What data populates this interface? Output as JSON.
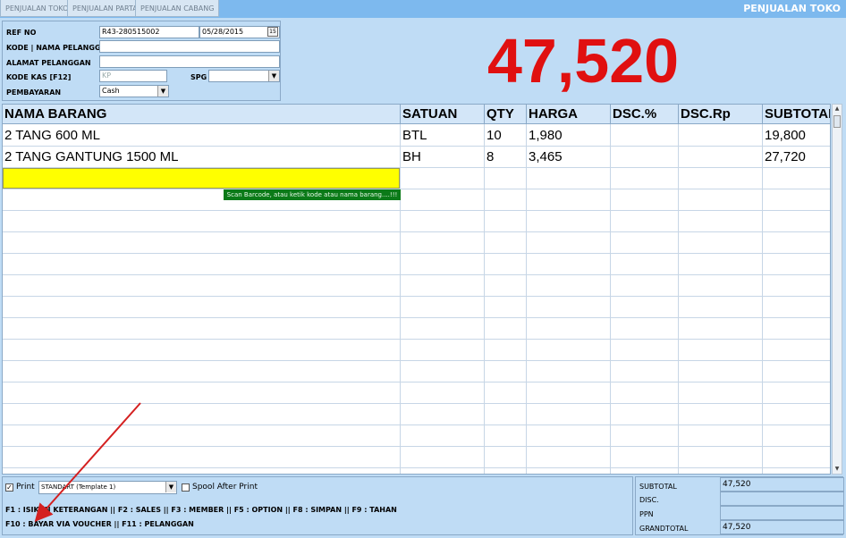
{
  "tabs": [
    {
      "label": "PENJUALAN TOKO"
    },
    {
      "label": "PENJUALAN PARTAI"
    },
    {
      "label": "PENJUALAN CABANG"
    }
  ],
  "app_title": "PENJUALAN TOKO",
  "form": {
    "ref_no_label": "REF NO",
    "ref_no_value": "R43-280515002",
    "date_value": "05/28/2015",
    "customer_label": "KODE | NAMA PELANGGAN",
    "address_label": "ALAMAT PELANGGAN",
    "kas_label": "KODE KAS [F12]",
    "kas_value": "KP",
    "spg_label": "SPG",
    "payment_label": "PEMBAYARAN",
    "payment_value": "Cash"
  },
  "grand_display": "47,520",
  "grid": {
    "columns": [
      "NAMA BARANG",
      "SATUAN",
      "QTY",
      "HARGA",
      "DSC.%",
      "DSC.Rp",
      "SUBTOTAL"
    ],
    "rows": [
      [
        "2 TANG 600 ML",
        "BTL",
        "10",
        "1,980",
        "",
        "",
        "19,800"
      ],
      [
        "2 TANG GANTUNG 1500 ML",
        "BH",
        "8",
        "3,465",
        "",
        "",
        "27,720"
      ]
    ],
    "hint": "Scan Barcode, atau ketik kode atau nama barang....!!!"
  },
  "print": {
    "print_label": "Print",
    "template_value": "STANDART (Template 1)",
    "spool_label": "Spool After Print"
  },
  "shortcuts": {
    "line1": "F1 : ISIKAN KETERANGAN || F2 : SALES || F3 : MEMBER || F5 : OPTION || F8 : SIMPAN || F9 : TAHAN",
    "line2": "F10 : BAYAR VIA VOUCHER  || F11 : PELANGGAN"
  },
  "totals": {
    "subtotal_label": "SUBTOTAL",
    "subtotal_value": "47,520",
    "disc_label": "DISC.",
    "ppn_label": "PPN",
    "grandtotal_label": "GRANDTOTAL",
    "grandtotal_value": "47,520"
  },
  "colors": {
    "total_red": "#e01010",
    "input_yellow": "#ffff00",
    "hint_green": "#0b7a18",
    "arrow_red": "#d42020"
  }
}
